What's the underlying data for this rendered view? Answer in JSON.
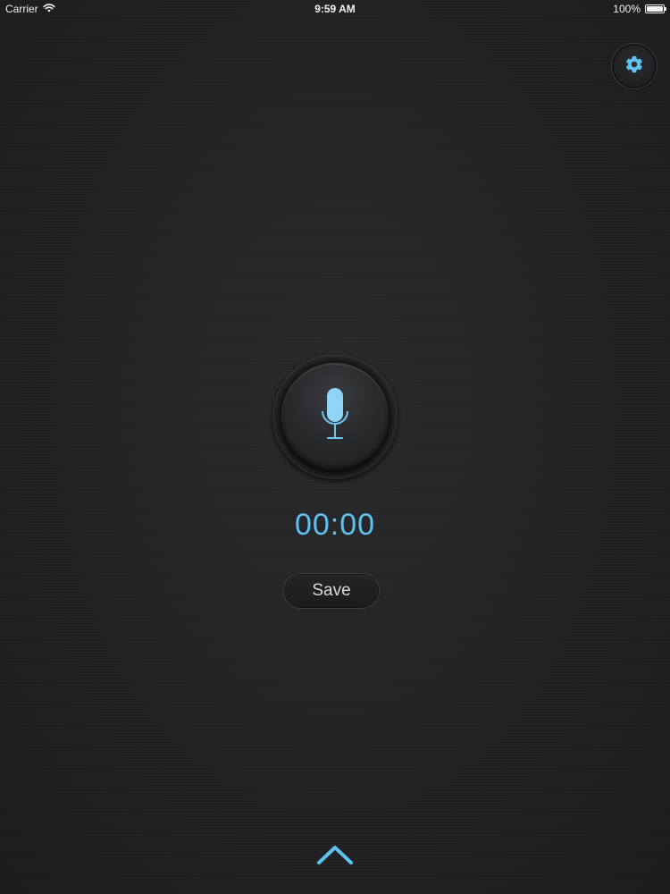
{
  "status_bar": {
    "carrier": "Carrier",
    "time": "9:59 AM",
    "battery_percent": "100%",
    "battery_level": 1.0,
    "wifi_icon": "wifi-icon"
  },
  "toolbar": {
    "settings_icon": "gear-icon"
  },
  "recorder": {
    "mic_icon": "microphone-icon",
    "timer": "00:00",
    "save_label": "Save"
  },
  "footer": {
    "expand_icon": "chevron-up-icon"
  },
  "colors": {
    "accent": "#5fc1ee",
    "background": "#222224",
    "text": "#d8d8d8"
  }
}
